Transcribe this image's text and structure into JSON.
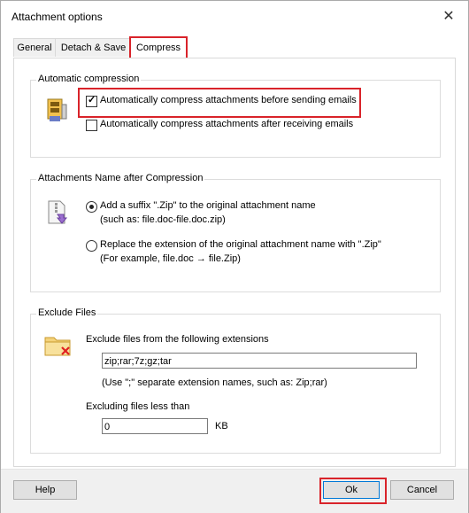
{
  "window": {
    "title": "Attachment options",
    "close_glyph": "✕"
  },
  "tabs": [
    {
      "label": "General"
    },
    {
      "label": "Detach & Save"
    },
    {
      "label": "Compress"
    }
  ],
  "auto_compression": {
    "label": "Automatic compression",
    "icon": "zip-archive-icon",
    "option_before": "Automatically compress attachments before sending emails",
    "option_before_checked": true,
    "option_after": "Automatically compress attachments after receiving emails",
    "option_after_checked": false
  },
  "name_after": {
    "label": "Attachments Name after Compression",
    "icon": "zip-file-icon",
    "suffix_line1": "Add a suffix \".Zip\" to the original attachment name",
    "suffix_line2": "(such as: file.doc-file.doc.zip)",
    "replace_line1": "Replace the extension of the original attachment name with \".Zip\"",
    "replace_line2": "(For example, file.doc → file.Zip)",
    "selected": "suffix"
  },
  "exclude": {
    "label": "Exclude Files",
    "icon": "folder-excluded-icon",
    "ext_label": "Exclude files from the following extensions",
    "ext_value": "zip;rar;7z;gz;tar",
    "ext_hint": "(Use \";\" separate extension names, such as: Zip;rar)",
    "size_label": "Excluding files less than",
    "size_value": "0",
    "size_unit": "KB"
  },
  "buttons": {
    "help": "Help",
    "ok": "Ok",
    "cancel": "Cancel"
  },
  "colors": {
    "highlight": "#d9232a",
    "accent": "#0078d7"
  }
}
